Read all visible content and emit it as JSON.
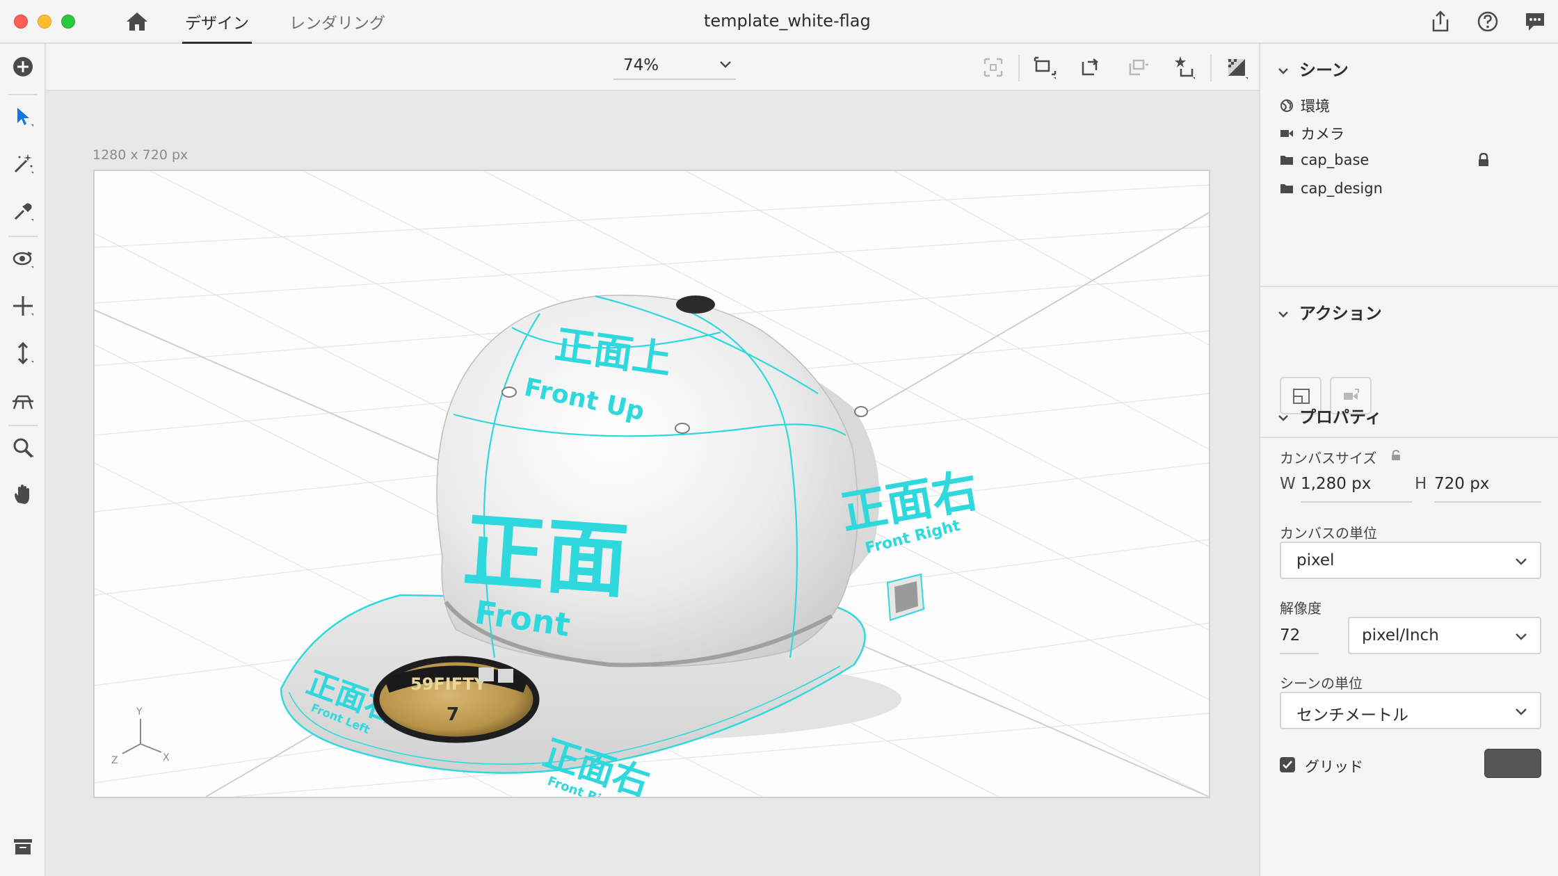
{
  "window": {
    "title": "template_white-flag",
    "tabs": [
      {
        "label": "デザイン",
        "active": true
      },
      {
        "label": "レンダリング",
        "active": false
      }
    ]
  },
  "options_bar": {
    "zoom": "74%"
  },
  "canvas": {
    "size_label": "1280 x 720 px",
    "axis_labels": {
      "y": "Y",
      "x": "X",
      "z": "Z"
    },
    "model_labels": {
      "front_up_jp": "正面上",
      "front_up_en": "Front Up",
      "front_jp": "正面",
      "front_en": "Front",
      "front_right_jp": "正面右",
      "front_right_en": "Front Right",
      "visor_left_jp": "正面右",
      "visor_left_en": "Front Left",
      "visor_right_jp": "正面右",
      "visor_right_en": "Front Right",
      "sticker_brand": "59FIFTY",
      "sticker_size": "7"
    }
  },
  "scene": {
    "title": "シーン",
    "items": [
      {
        "label": "環境",
        "icon": "globe-icon"
      },
      {
        "label": "カメラ",
        "icon": "camera-icon"
      },
      {
        "label": "cap_base",
        "icon": "folder-icon",
        "locked": true
      },
      {
        "label": "cap_design",
        "icon": "folder-icon"
      }
    ]
  },
  "actions": {
    "title": "アクション"
  },
  "properties": {
    "title": "プロパティ",
    "canvas_size_label": "カンバスサイズ",
    "w_label": "W",
    "w_value": "1,280 px",
    "h_label": "H",
    "h_value": "720 px",
    "canvas_unit_label": "カンバスの単位",
    "canvas_unit_value": "pixel",
    "resolution_label": "解像度",
    "resolution_value": "72",
    "resolution_unit": "pixel/Inch",
    "scene_unit_label": "シーンの単位",
    "scene_unit_value": "センチメートル",
    "grid_label": "グリッド",
    "grid_checked": true,
    "grid_color": "#555555"
  },
  "colors": {
    "accent_cyan": "#2ed8dc",
    "selection_blue": "#1473e6"
  }
}
